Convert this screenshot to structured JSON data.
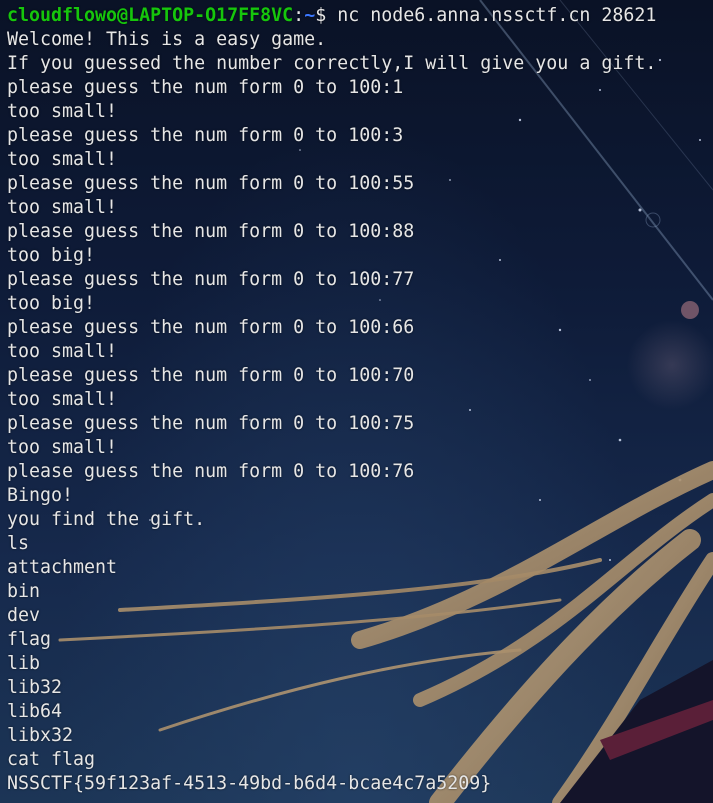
{
  "terminal": {
    "prompt": {
      "user_host": "cloudflowo@LAPTOP-O17FF8VC",
      "separator": ":",
      "path": "~",
      "symbol": "$ ",
      "command": "nc node6.anna.nssctf.cn 28621"
    },
    "lines": [
      "Welcome! This is a easy game.",
      "If you guessed the number correctly,I will give you a gift.",
      "please guess the num form 0 to 100:1",
      "too small!",
      "please guess the num form 0 to 100:3",
      "too small!",
      "please guess the num form 0 to 100:55",
      "too small!",
      "please guess the num form 0 to 100:88",
      "too big!",
      "please guess the num form 0 to 100:77",
      "too big!",
      "please guess the num form 0 to 100:66",
      "too small!",
      "please guess the num form 0 to 100:70",
      "too small!",
      "please guess the num form 0 to 100:75",
      "too small!",
      "please guess the num form 0 to 100:76",
      "Bingo!",
      "you find the gift.",
      "ls",
      "attachment",
      "bin",
      "dev",
      "flag",
      "lib",
      "lib32",
      "lib64",
      "libx32",
      "cat flag",
      "NSSCTF{59f123af-4513-49bd-b6d4-bcae4c7a5209}"
    ]
  },
  "colors": {
    "prompt_user": "#16c60c",
    "prompt_path": "#3b78ff",
    "text": "#e6e6e6"
  }
}
